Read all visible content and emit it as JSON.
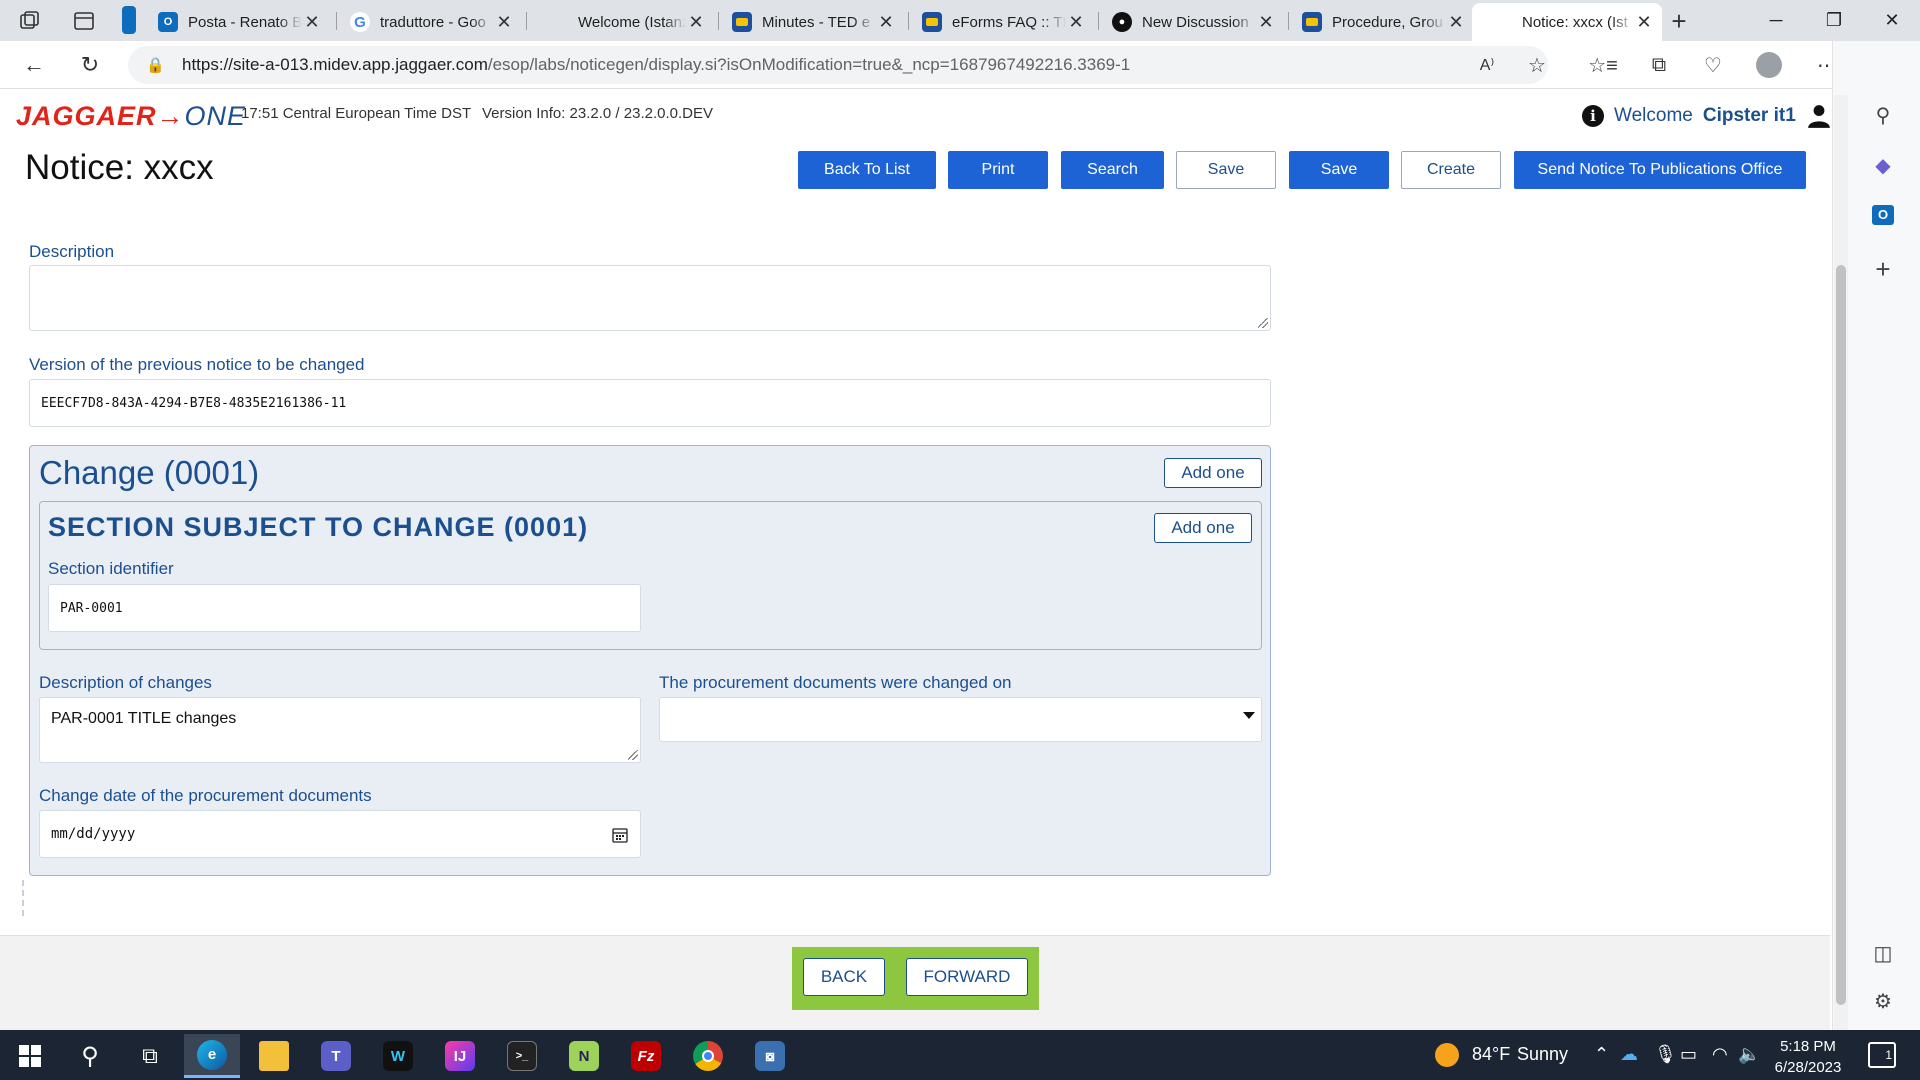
{
  "browser": {
    "tabs": [
      {
        "title": "Posta - Renato B",
        "favicon": "outlook-icon",
        "color": "#0f6cbd",
        "glyph": "O"
      },
      {
        "title": "traduttore - Goo",
        "favicon": "google-icon",
        "color": "#ffffff",
        "glyph": "G"
      },
      {
        "title": "Welcome (Istanz",
        "favicon": "",
        "color": "",
        "glyph": ""
      },
      {
        "title": "Minutes - TED e",
        "favicon": "ted-icon",
        "color": "#1f4e9e",
        "glyph": ""
      },
      {
        "title": "eForms FAQ :: TE",
        "favicon": "ted-icon",
        "color": "#1f4e9e",
        "glyph": ""
      },
      {
        "title": "New Discussion",
        "favicon": "github-icon",
        "color": "#111111",
        "glyph": ""
      },
      {
        "title": "Procedure, Grou",
        "favicon": "ted-icon",
        "color": "#1f4e9e",
        "glyph": ""
      },
      {
        "title": "Notice: xxcx (Ist",
        "favicon": "",
        "color": "",
        "glyph": ""
      }
    ],
    "url_host": "https://site-a-013.midev.app.jaggaer.com",
    "url_path": "/esop/labs/noticegen/display.si?isOnModification=true&_ncp=1687967492216.3369-1"
  },
  "header": {
    "logo_main": "JAGGAER",
    "logo_suffix": "ONE",
    "time": "17:51 Central European Time DST",
    "version": "Version Info: 23.2.0 / 23.2.0.0.DEV",
    "welcome": "Welcome",
    "user": "Cipster it1"
  },
  "toolbar": {
    "title": "Notice: xxcx",
    "back_to_list": "Back To List",
    "print": "Print",
    "search": "Search",
    "save_draft": "Save",
    "save": "Save",
    "create": "Create",
    "send": "Send Notice To Publications Office"
  },
  "form": {
    "description_label": "Description",
    "description_value": "",
    "prev_version_label": "Version of the previous notice to be changed",
    "prev_version_value": "EEECF7D8-843A-4294-B7E8-4835E2161386-11",
    "change_title": "Change (0001)",
    "add_one": "Add one",
    "section_title": "SECTION SUBJECT TO CHANGE (0001)",
    "section_id_label": "Section identifier",
    "section_id_value": "PAR-0001",
    "desc_changes_label": "Description of changes",
    "desc_changes_value": "PAR-0001 TITLE changes",
    "docs_changed_label": "The procurement documents were changed on",
    "docs_changed_value": "",
    "change_date_label": "Change date of the procurement documents",
    "change_date_placeholder": "mm/dd/yyyy"
  },
  "footer": {
    "back": "BACK",
    "forward": "FORWARD"
  },
  "taskbar": {
    "weather_temp": "84°F",
    "weather_text": "Sunny",
    "time": "5:18 PM",
    "date": "6/28/2023",
    "notifications": "1"
  },
  "colors": {
    "accent": "#1e63d6",
    "label": "#1c4f8f",
    "brand_red": "#e2231a",
    "nav_green": "#8dc63f"
  }
}
